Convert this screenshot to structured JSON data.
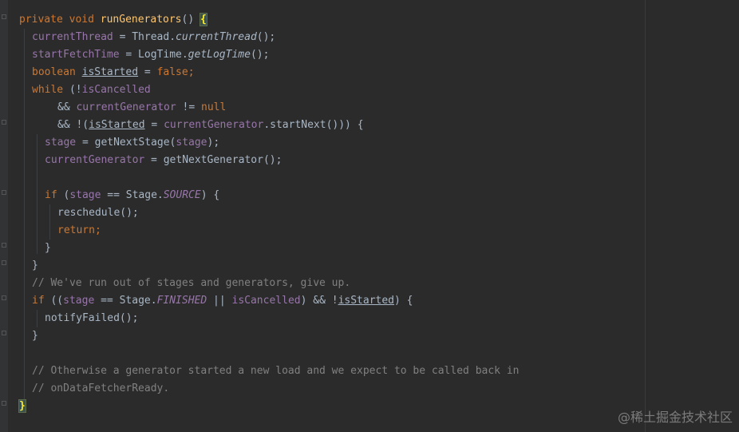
{
  "code": {
    "lines": [
      [
        [
          "private ",
          "kw"
        ],
        [
          "void ",
          "kw"
        ],
        [
          "runGenerators",
          "fn"
        ],
        [
          "() ",
          ""
        ],
        [
          "{",
          "brace-hl"
        ]
      ],
      [
        [
          "currentThread",
          "fld"
        ],
        [
          " = Thread.",
          ""
        ],
        [
          "currentThread",
          "ital"
        ],
        [
          "();",
          ""
        ]
      ],
      [
        [
          "startFetchTime",
          "fld"
        ],
        [
          " = LogTime.",
          ""
        ],
        [
          "getLogTime",
          "ital"
        ],
        [
          "();",
          ""
        ]
      ],
      [
        [
          "boolean ",
          "kw"
        ],
        [
          "isStarted",
          "und"
        ],
        [
          " = ",
          ""
        ],
        [
          "false",
          "kw"
        ],
        [
          ";",
          "kw"
        ]
      ],
      [
        [
          "while ",
          "kw"
        ],
        [
          "(!",
          ""
        ],
        [
          "isCancelled",
          "fld"
        ]
      ],
      [
        [
          "&& ",
          ""
        ],
        [
          "currentGenerator",
          "fld"
        ],
        [
          " != ",
          ""
        ],
        [
          "null",
          "kw"
        ]
      ],
      [
        [
          "&& !(",
          ""
        ],
        [
          "isStarted",
          "und"
        ],
        [
          " = ",
          ""
        ],
        [
          "currentGenerator",
          "fld"
        ],
        [
          ".startNext())) {",
          ""
        ]
      ],
      [
        [
          "stage",
          "fld"
        ],
        [
          " = getNextStage(",
          ""
        ],
        [
          "stage",
          "fld"
        ],
        [
          ");",
          ""
        ]
      ],
      [
        [
          "currentGenerator",
          "fld"
        ],
        [
          " = getNextGenerator();",
          ""
        ]
      ],
      [],
      [
        [
          "if ",
          "kw"
        ],
        [
          "(",
          ""
        ],
        [
          "stage",
          "fld"
        ],
        [
          " == Stage.",
          ""
        ],
        [
          "SOURCE",
          "fldi"
        ],
        [
          ") {",
          ""
        ]
      ],
      [
        [
          "reschedule();",
          ""
        ]
      ],
      [
        [
          "return",
          "kw"
        ],
        [
          ";",
          "kw"
        ]
      ],
      [
        [
          "}",
          ""
        ]
      ],
      [
        [
          "}",
          ""
        ]
      ],
      [
        [
          "// We've run out of stages and generators, give up.",
          "cmt"
        ]
      ],
      [
        [
          "if ",
          "kw"
        ],
        [
          "((",
          ""
        ],
        [
          "stage",
          "fld"
        ],
        [
          " == Stage.",
          ""
        ],
        [
          "FINISHED",
          "fldi"
        ],
        [
          " || ",
          ""
        ],
        [
          "isCancelled",
          "fld"
        ],
        [
          ") && !",
          ""
        ],
        [
          "isStarted",
          "und"
        ],
        [
          ") {",
          ""
        ]
      ],
      [
        [
          "notifyFailed();",
          ""
        ]
      ],
      [
        [
          "}",
          ""
        ]
      ],
      [],
      [
        [
          "// Otherwise a generator started a new load and we expect to be called back in",
          "cmt"
        ]
      ],
      [
        [
          "// onDataFetcherReady.",
          "cmt"
        ]
      ],
      [
        [
          "}",
          "brace-hl"
        ]
      ]
    ]
  },
  "watermark": "@稀土掘金技术社区",
  "colors": {
    "background": "#2b2b2b",
    "keyword": "#cc7832",
    "method": "#ffc66d",
    "field": "#9876aa",
    "comment": "#808080",
    "text": "#a9b7c6"
  }
}
